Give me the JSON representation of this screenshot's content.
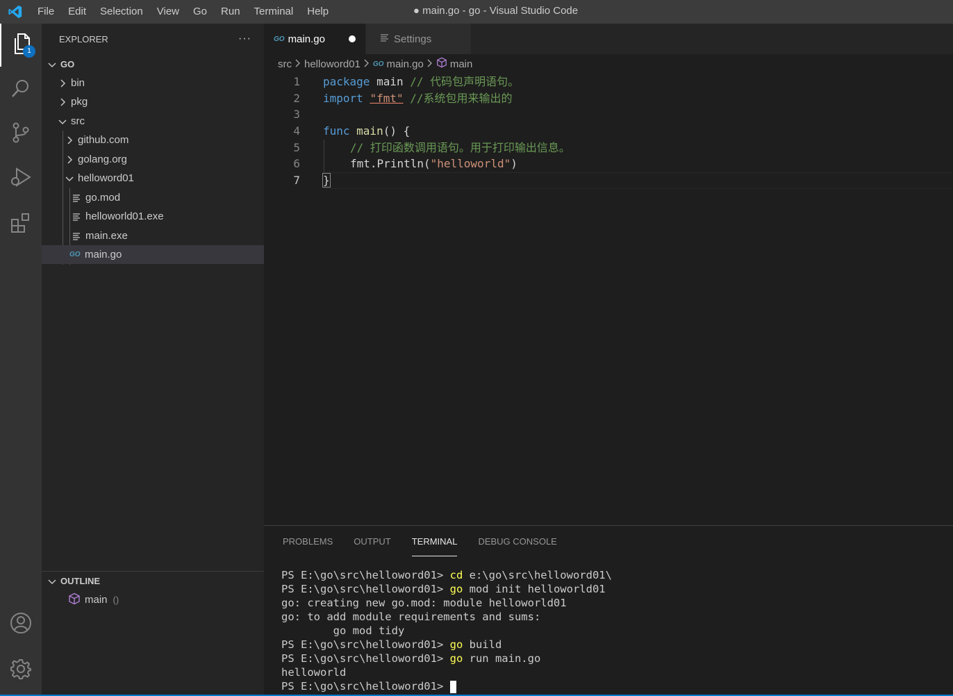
{
  "window": {
    "title": "● main.go - go - Visual Studio Code"
  },
  "menu": [
    "File",
    "Edit",
    "Selection",
    "View",
    "Go",
    "Run",
    "Terminal",
    "Help"
  ],
  "activity": {
    "badge": "1"
  },
  "explorer": {
    "header": "EXPLORER",
    "more": "···",
    "root": "GO",
    "items": [
      {
        "label": "bin"
      },
      {
        "label": "pkg"
      },
      {
        "label": "src"
      },
      {
        "label": "github.com"
      },
      {
        "label": "golang.org"
      },
      {
        "label": "helloword01"
      },
      {
        "label": "go.mod"
      },
      {
        "label": "helloworld01.exe"
      },
      {
        "label": "main.exe"
      },
      {
        "label": "main.go"
      }
    ]
  },
  "outline": {
    "header": "OUTLINE",
    "item": "main",
    "item_detail": "()"
  },
  "tabs": [
    {
      "label": "main.go",
      "dirty": true
    },
    {
      "label": "Settings"
    }
  ],
  "breadcrumb": [
    "src",
    "helloword01",
    "main.go",
    "main"
  ],
  "code": {
    "line_numbers": [
      "1",
      "2",
      "3",
      "4",
      "5",
      "6",
      "7"
    ],
    "l1": {
      "kw": "package",
      "pl": " main ",
      "cmt": "// 代码包声明语句。"
    },
    "l2": {
      "kw": "import",
      "pl": " ",
      "str": "\"fmt\"",
      "cmt": " //系统包用来输出的"
    },
    "l4": {
      "kw": "func",
      "fn": " main",
      "pl": "() {"
    },
    "l5": {
      "cmt": "// 打印函数调用语句。用于打印输出信息。"
    },
    "l6": {
      "id": "fmt",
      "pl": ".",
      "fn": "Println",
      "p2": "(",
      "str": "\"helloworld\"",
      "p3": ")"
    },
    "l7": {
      "pl": "}"
    }
  },
  "panel": {
    "tabs": [
      "PROBLEMS",
      "OUTPUT",
      "TERMINAL",
      "DEBUG CONSOLE"
    ],
    "terminal": [
      {
        "p": "PS E:\\go\\src\\helloword01> ",
        "y": "cd",
        "r": " e:\\go\\src\\helloword01\\"
      },
      {
        "p": "PS E:\\go\\src\\helloword01> ",
        "y": "go",
        "r": " mod init helloworld01"
      },
      {
        "p": "go: creating new go.mod: module helloworld01",
        "y": "",
        "r": ""
      },
      {
        "p": "go: to add module requirements and sums:",
        "y": "",
        "r": ""
      },
      {
        "p": "        go mod tidy",
        "y": "",
        "r": ""
      },
      {
        "p": "PS E:\\go\\src\\helloword01> ",
        "y": "go",
        "r": " build"
      },
      {
        "p": "PS E:\\go\\src\\helloword01> ",
        "y": "go",
        "r": " run main.go"
      },
      {
        "p": "helloworld",
        "y": "",
        "r": ""
      },
      {
        "p": "PS E:\\go\\src\\helloword01> ",
        "y": "",
        "r": ""
      }
    ]
  },
  "colors": {
    "accent": "#007acc",
    "keyword": "#569cd6",
    "string": "#ce9178",
    "comment": "#6a9955",
    "function": "#dcdcaa",
    "go_icon": "#519aba"
  }
}
